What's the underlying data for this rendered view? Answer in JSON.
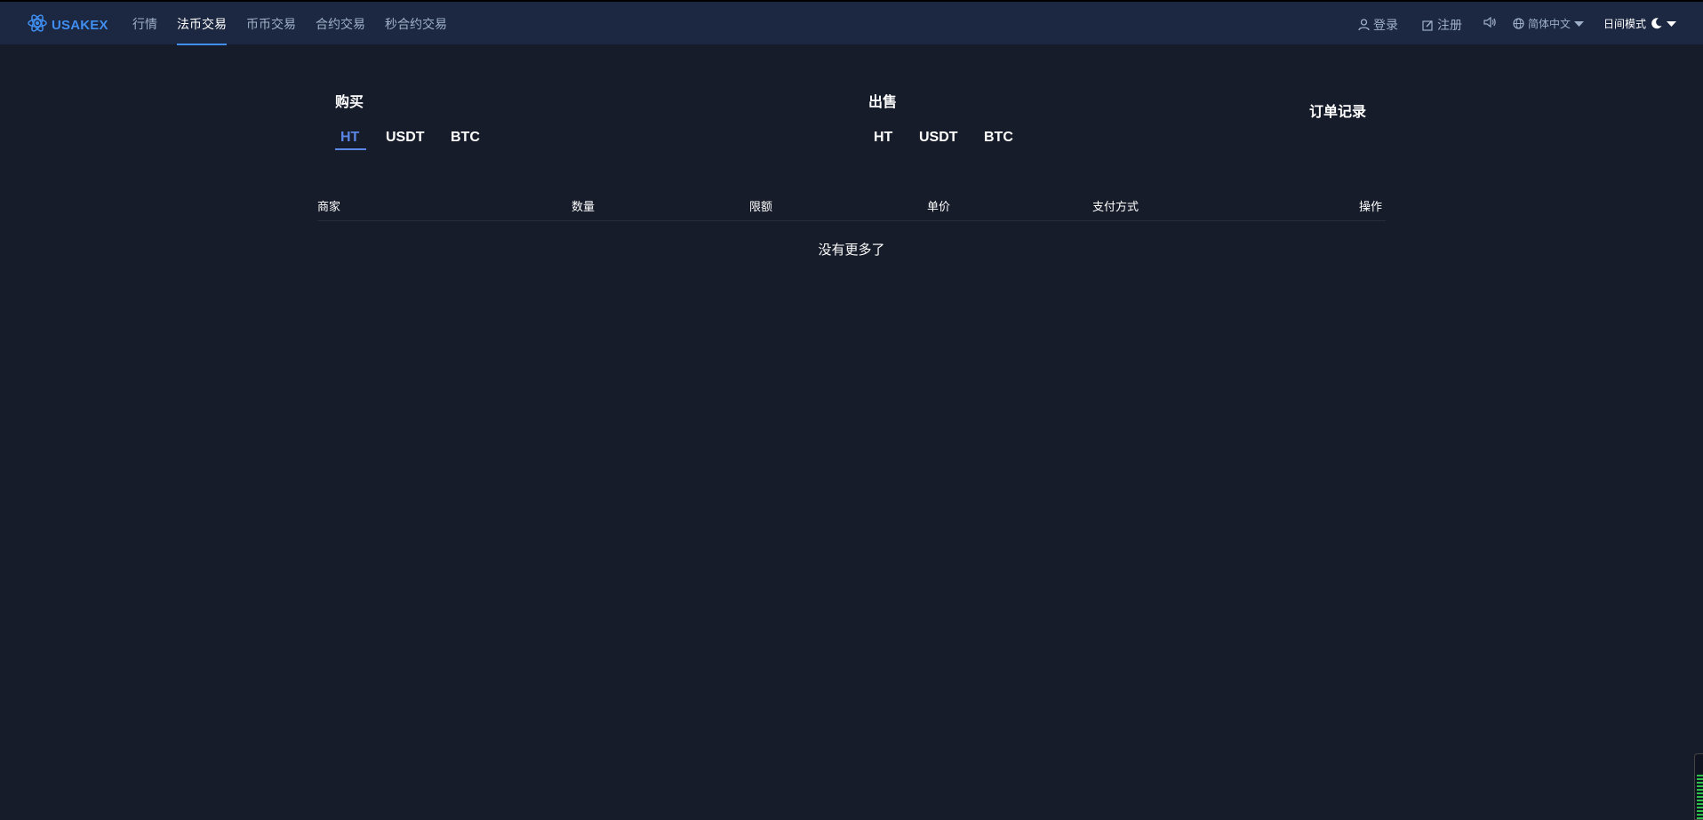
{
  "header": {
    "logo_text": "USAKEX",
    "nav": [
      {
        "label": "行情",
        "active": false
      },
      {
        "label": "法币交易",
        "active": true
      },
      {
        "label": "币币交易",
        "active": false
      },
      {
        "label": "合约交易",
        "active": false
      },
      {
        "label": "秒合约交易",
        "active": false
      }
    ],
    "login_label": "登录",
    "register_label": "注册",
    "language_label": "简体中文",
    "mode_label": "日间模式"
  },
  "buy": {
    "title": "购买",
    "coins": [
      "HT",
      "USDT",
      "BTC"
    ],
    "active_coin": "HT"
  },
  "sell": {
    "title": "出售",
    "coins": [
      "HT",
      "USDT",
      "BTC"
    ]
  },
  "order_record_label": "订单记录",
  "table": {
    "columns": [
      "商家",
      "数量",
      "限额",
      "单价",
      "支付方式",
      "操作"
    ],
    "empty_text": "没有更多了"
  },
  "colors": {
    "background": "#171c2a",
    "header_bg": "#1c2741",
    "accent": "#3f8ef0",
    "active_tab": "#5a86e6"
  }
}
